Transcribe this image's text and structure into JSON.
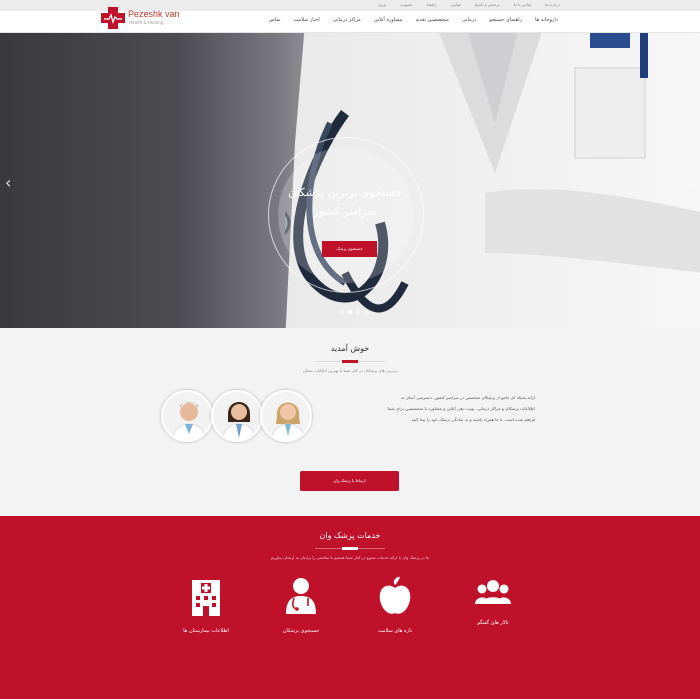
{
  "topbar": {
    "links": [
      "درباره ما",
      "تماس با ما",
      "پرسش و پاسخ",
      "قوانین",
      "راهنما",
      "عضویت",
      "ورود"
    ]
  },
  "logo": {
    "name": "Pezeshk van",
    "tagline": "Health & Healing"
  },
  "nav": {
    "items": [
      "داروخانه ها",
      "راهنمای جستجو",
      "درمانی",
      "متخصصین تغذیه",
      "مشاوره آنلاین",
      "مراکز درمانی",
      "اخبار سلامت",
      "تماس"
    ]
  },
  "hero": {
    "title": "جستجوی برترین پزشکان سراسر کشور",
    "button": "جستجوی پزشک",
    "prev": "‹",
    "next": "›",
    "slides": 4,
    "active": 1
  },
  "welcome": {
    "title": "خوش آمدید",
    "subtitle": "برترین های پزشکان در کنار شما با بهترین امکانات ممکن",
    "text": "ارائه شبکه ای جامع از پزشکان متخصص در سراسر کشور، دسترسی آسان به اطلاعات پزشکان و مراکز درمانی، نوبت دهی آنلاین و مشاوره با متخصصین برای شما فراهم شده است. با ما همراه باشید و به سادگی پزشک خود را پیدا کنید.",
    "button": "ارتباط با پزشک وان"
  },
  "services": {
    "title": "خدمات پزشک وان",
    "subtitle": "ما در پزشک وان با ارائه خدمات متنوع در کنار شما هستیم تا سلامتی را برایتان به ارمغان بیاوریم",
    "items": [
      {
        "label": "تالار های گفتگو",
        "icon": "users-icon"
      },
      {
        "label": "تازه های سلامت",
        "icon": "apple-icon"
      },
      {
        "label": "جستجوی پزشکان",
        "icon": "doctor-icon"
      },
      {
        "label": "اطلاعات بیمارستان ها",
        "icon": "hospital-icon"
      }
    ]
  },
  "colors": {
    "brand": "#c0112b",
    "topbar": "#ececec",
    "welcome_bg": "#f3f3f3"
  }
}
